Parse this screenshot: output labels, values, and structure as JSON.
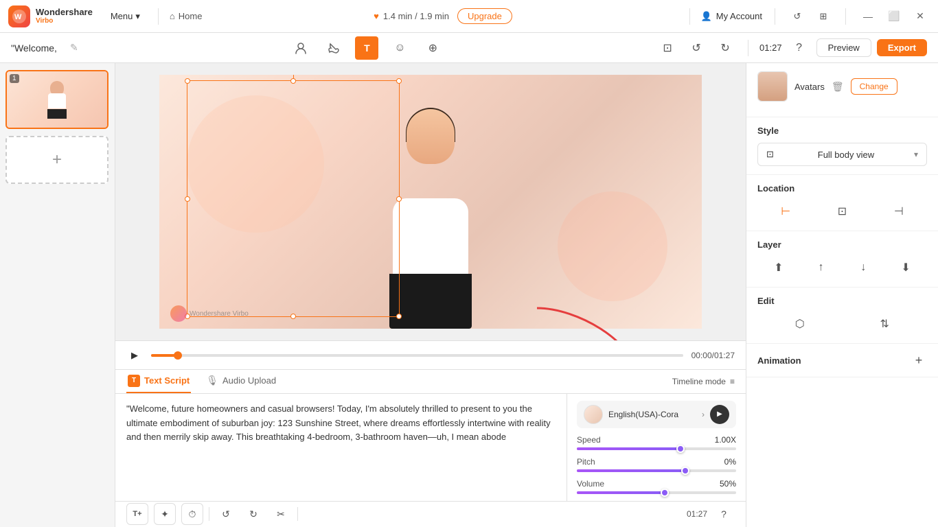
{
  "app": {
    "name": "Wondershare",
    "product": "Virbo",
    "menu_label": "Menu",
    "home_label": "Home"
  },
  "topbar": {
    "duration": "1.4 min / 1.9 min",
    "upgrade_label": "Upgrade",
    "account_label": "My Account"
  },
  "toolbar2": {
    "title": "\"Welcome,",
    "time": "01:27",
    "preview_label": "Preview",
    "export_label": "Export"
  },
  "tools": {
    "avatar_icon": "👤",
    "brush_icon": "✏️",
    "text_icon": "T",
    "emoji_icon": "😊",
    "add_icon": "+"
  },
  "canvas": {
    "watermark_text": "Wondershare Virbo"
  },
  "playback": {
    "time": "00:00/01:27"
  },
  "script": {
    "tab_text": "Text Script",
    "tab_audio": "Audio Upload",
    "timeline_mode": "Timeline mode",
    "content": "\"Welcome, future homeowners and casual browsers! Today, I'm absolutely thrilled to present to you the ultimate embodiment of suburban joy: 123 Sunshine Street, where dreams effortlessly intertwine with reality and then merrily skip away. This breathtaking 4-bedroom, 3-bathroom haven—uh, I mean abode"
  },
  "voice": {
    "name": "English(USA)-Cora",
    "speed_label": "Speed",
    "speed_value": "1.00X",
    "speed_pct": 65,
    "pitch_label": "Pitch",
    "pitch_value": "0%",
    "pitch_pct": 68,
    "volume_label": "Volume",
    "volume_value": "50%",
    "volume_pct": 55
  },
  "bottom_toolbar": {
    "time": "01:27"
  },
  "right_panel": {
    "avatars_label": "Avatars",
    "change_label": "Change",
    "style_label": "Style",
    "style_value": "Full body view",
    "location_label": "Location",
    "layer_label": "Layer",
    "edit_label": "Edit",
    "animation_label": "Animation"
  },
  "slides": [
    {
      "num": "1",
      "active": true
    }
  ]
}
